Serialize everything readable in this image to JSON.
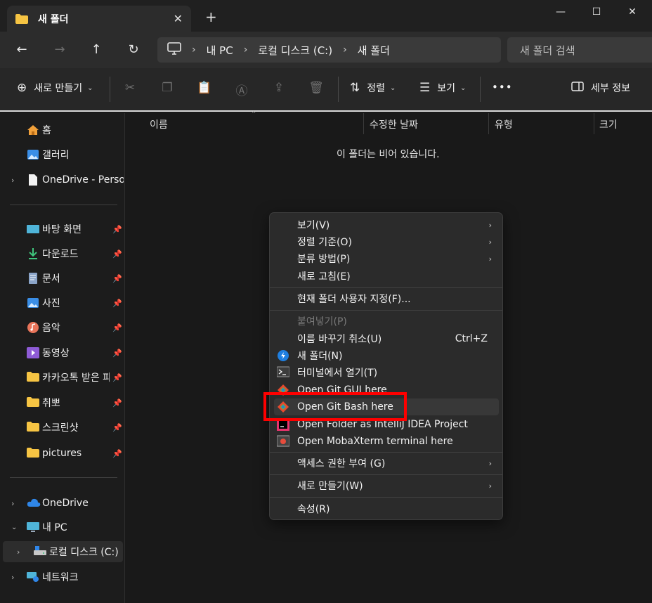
{
  "window": {
    "tab_title": "새 폴더",
    "tab_close": "✕",
    "new_tab": "+",
    "minimize": "—",
    "maximize": "☐",
    "close": "✕"
  },
  "nav": {
    "back": "←",
    "forward": "→",
    "up": "↑",
    "refresh": "↻",
    "breadcrumb": [
      "내 PC",
      "로컬 디스크 (C:)",
      "새 폴더"
    ],
    "search_placeholder": "새 폴더 검색"
  },
  "toolbar": {
    "new_label": "새로 만들기",
    "sort_label": "정렬",
    "view_label": "보기",
    "more_label": "•••",
    "details_label": "세부 정보"
  },
  "sidebar": {
    "items": [
      {
        "label": "홈",
        "icon": "home-icon"
      },
      {
        "label": "갤러리",
        "icon": "gallery-icon"
      },
      {
        "label": "OneDrive - Personal",
        "icon": "document-icon"
      },
      {
        "label": "바탕 화면",
        "icon": "desktop-icon"
      },
      {
        "label": "다운로드",
        "icon": "download-icon"
      },
      {
        "label": "문서",
        "icon": "documents-icon"
      },
      {
        "label": "사진",
        "icon": "pictures-icon"
      },
      {
        "label": "음악",
        "icon": "music-icon"
      },
      {
        "label": "동영상",
        "icon": "video-icon"
      },
      {
        "label": "카카오톡 받은 파일",
        "icon": "folder-icon"
      },
      {
        "label": "취뽀",
        "icon": "folder-icon"
      },
      {
        "label": "스크린샷",
        "icon": "folder-icon"
      },
      {
        "label": "pictures",
        "icon": "folder-icon"
      },
      {
        "label": "OneDrive",
        "icon": "cloud-icon"
      },
      {
        "label": "내 PC",
        "icon": "pc-icon"
      },
      {
        "label": "로컬 디스크 (C:)",
        "icon": "drive-icon"
      },
      {
        "label": "네트워크",
        "icon": "network-icon"
      }
    ]
  },
  "columns": [
    "이름",
    "수정한 날짜",
    "유형",
    "크기"
  ],
  "empty_message": "이 폴더는 비어 있습니다.",
  "context_menu": {
    "items": [
      {
        "label": "보기(V)",
        "arrow": "›"
      },
      {
        "label": "정렬 기준(O)",
        "arrow": "›"
      },
      {
        "label": "분류 방법(P)",
        "arrow": "›"
      },
      {
        "label": "새로 고침(E)"
      },
      {
        "label": "현재 폴더 사용자 지정(F)..."
      },
      {
        "label": "붙여넣기(P)"
      },
      {
        "label": "이름 바꾸기 취소(U)",
        "accelerator": "Ctrl+Z"
      },
      {
        "label": "새 폴더(N)"
      },
      {
        "label": "터미널에서 열기(T)"
      },
      {
        "label": "Open Git GUI here"
      },
      {
        "label": "Open Git Bash here"
      },
      {
        "label": "Open Folder as IntelliJ IDEA Project"
      },
      {
        "label": "Open MobaXterm terminal here"
      },
      {
        "label": "액세스 권한 부여 (G)",
        "arrow": "›"
      },
      {
        "label": "새로 만들기(W)",
        "arrow": "›"
      },
      {
        "label": "속성(R)"
      }
    ]
  },
  "colors": {
    "highlight": "#ff0000",
    "folder": "#f6c443"
  }
}
